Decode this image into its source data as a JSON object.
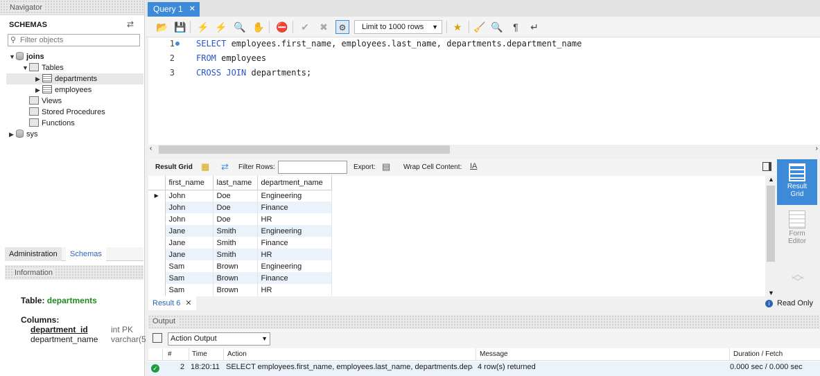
{
  "navigator": {
    "title": "Navigator",
    "schemas_label": "SCHEMAS",
    "filter_placeholder": "Filter objects",
    "tree": {
      "db_joins": "joins",
      "tables": "Tables",
      "departments": "departments",
      "employees": "employees",
      "views": "Views",
      "stored_procedures": "Stored Procedures",
      "functions": "Functions",
      "db_sys": "sys"
    },
    "tabs": {
      "administration": "Administration",
      "schemas": "Schemas"
    },
    "info_title": "Information",
    "info": {
      "table_prefix": "Table:",
      "table_name": "departments",
      "columns_label": "Columns:",
      "col1_name": "department_id",
      "col1_type": "int PK",
      "col2_name": "department_name",
      "col2_type": "varchar(5"
    }
  },
  "editor": {
    "tab_label": "Query 1",
    "limit_label": "Limit to 1000 rows",
    "lines": [
      {
        "num": "1",
        "kw1": "SELECT",
        "rest": " employees.first_name, employees.last_name, departments.department_name"
      },
      {
        "num": "2",
        "kw1": "FROM",
        "rest": " employees"
      },
      {
        "num": "3",
        "kw1": "CROSS JOIN",
        "rest": " departments;"
      }
    ]
  },
  "result_toolbar": {
    "result_grid": "Result Grid",
    "filter_rows": "Filter Rows:",
    "export": "Export:",
    "wrap_cell": "Wrap Cell Content:"
  },
  "grid": {
    "columns": [
      "first_name",
      "last_name",
      "department_name"
    ],
    "rows": [
      [
        "John",
        "Doe",
        "Engineering"
      ],
      [
        "John",
        "Doe",
        "Finance"
      ],
      [
        "John",
        "Doe",
        "HR"
      ],
      [
        "Jane",
        "Smith",
        "Engineering"
      ],
      [
        "Jane",
        "Smith",
        "Finance"
      ],
      [
        "Jane",
        "Smith",
        "HR"
      ],
      [
        "Sam",
        "Brown",
        "Engineering"
      ],
      [
        "Sam",
        "Brown",
        "Finance"
      ],
      [
        "Sam",
        "Brown",
        "HR"
      ]
    ]
  },
  "side_panel": {
    "result_grid_line1": "Result",
    "result_grid_line2": "Grid",
    "form_editor_line1": "Form",
    "form_editor_line2": "Editor"
  },
  "result_tab": {
    "label": "Result 6",
    "read_only": "Read Only"
  },
  "output": {
    "title": "Output",
    "selector": "Action Output",
    "headers": {
      "num": "#",
      "time": "Time",
      "action": "Action",
      "message": "Message",
      "duration": "Duration / Fetch"
    },
    "row": {
      "num": "2",
      "time": "18:20:11",
      "action": "SELECT employees.first_name, employees.last_name, departments.depar...",
      "message": "4 row(s) returned",
      "duration": "0.000 sec / 0.000 sec"
    }
  },
  "colors": {
    "accent": "#3c8ad8",
    "keyword": "#2a55c9",
    "green": "#1f8a1f",
    "ok": "#1f9a3a"
  }
}
